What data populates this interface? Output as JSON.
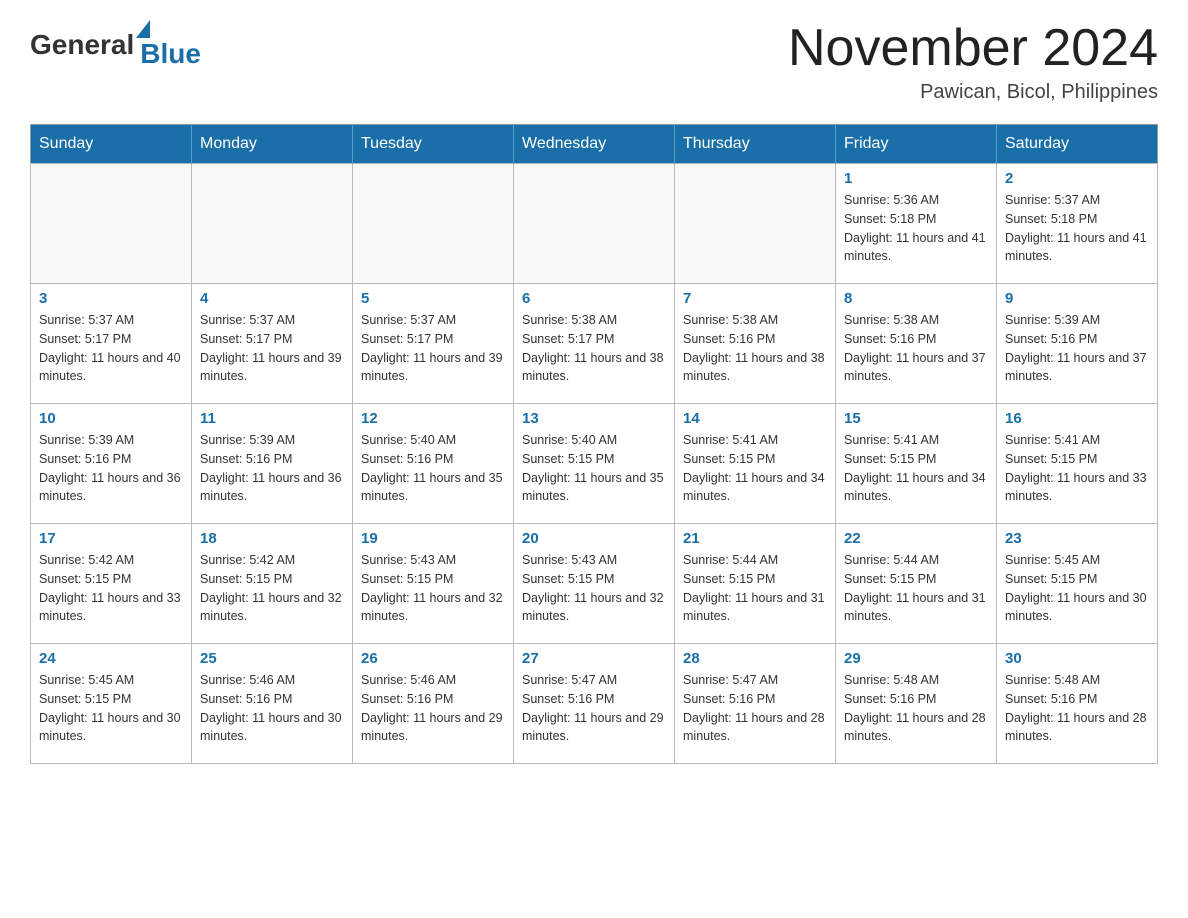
{
  "header": {
    "logo_general": "General",
    "logo_blue": "Blue",
    "month_year": "November 2024",
    "location": "Pawican, Bicol, Philippines"
  },
  "weekdays": [
    "Sunday",
    "Monday",
    "Tuesday",
    "Wednesday",
    "Thursday",
    "Friday",
    "Saturday"
  ],
  "weeks": [
    [
      {
        "day": "",
        "info": ""
      },
      {
        "day": "",
        "info": ""
      },
      {
        "day": "",
        "info": ""
      },
      {
        "day": "",
        "info": ""
      },
      {
        "day": "",
        "info": ""
      },
      {
        "day": "1",
        "info": "Sunrise: 5:36 AM\nSunset: 5:18 PM\nDaylight: 11 hours and 41 minutes."
      },
      {
        "day": "2",
        "info": "Sunrise: 5:37 AM\nSunset: 5:18 PM\nDaylight: 11 hours and 41 minutes."
      }
    ],
    [
      {
        "day": "3",
        "info": "Sunrise: 5:37 AM\nSunset: 5:17 PM\nDaylight: 11 hours and 40 minutes."
      },
      {
        "day": "4",
        "info": "Sunrise: 5:37 AM\nSunset: 5:17 PM\nDaylight: 11 hours and 39 minutes."
      },
      {
        "day": "5",
        "info": "Sunrise: 5:37 AM\nSunset: 5:17 PM\nDaylight: 11 hours and 39 minutes."
      },
      {
        "day": "6",
        "info": "Sunrise: 5:38 AM\nSunset: 5:17 PM\nDaylight: 11 hours and 38 minutes."
      },
      {
        "day": "7",
        "info": "Sunrise: 5:38 AM\nSunset: 5:16 PM\nDaylight: 11 hours and 38 minutes."
      },
      {
        "day": "8",
        "info": "Sunrise: 5:38 AM\nSunset: 5:16 PM\nDaylight: 11 hours and 37 minutes."
      },
      {
        "day": "9",
        "info": "Sunrise: 5:39 AM\nSunset: 5:16 PM\nDaylight: 11 hours and 37 minutes."
      }
    ],
    [
      {
        "day": "10",
        "info": "Sunrise: 5:39 AM\nSunset: 5:16 PM\nDaylight: 11 hours and 36 minutes."
      },
      {
        "day": "11",
        "info": "Sunrise: 5:39 AM\nSunset: 5:16 PM\nDaylight: 11 hours and 36 minutes."
      },
      {
        "day": "12",
        "info": "Sunrise: 5:40 AM\nSunset: 5:16 PM\nDaylight: 11 hours and 35 minutes."
      },
      {
        "day": "13",
        "info": "Sunrise: 5:40 AM\nSunset: 5:15 PM\nDaylight: 11 hours and 35 minutes."
      },
      {
        "day": "14",
        "info": "Sunrise: 5:41 AM\nSunset: 5:15 PM\nDaylight: 11 hours and 34 minutes."
      },
      {
        "day": "15",
        "info": "Sunrise: 5:41 AM\nSunset: 5:15 PM\nDaylight: 11 hours and 34 minutes."
      },
      {
        "day": "16",
        "info": "Sunrise: 5:41 AM\nSunset: 5:15 PM\nDaylight: 11 hours and 33 minutes."
      }
    ],
    [
      {
        "day": "17",
        "info": "Sunrise: 5:42 AM\nSunset: 5:15 PM\nDaylight: 11 hours and 33 minutes."
      },
      {
        "day": "18",
        "info": "Sunrise: 5:42 AM\nSunset: 5:15 PM\nDaylight: 11 hours and 32 minutes."
      },
      {
        "day": "19",
        "info": "Sunrise: 5:43 AM\nSunset: 5:15 PM\nDaylight: 11 hours and 32 minutes."
      },
      {
        "day": "20",
        "info": "Sunrise: 5:43 AM\nSunset: 5:15 PM\nDaylight: 11 hours and 32 minutes."
      },
      {
        "day": "21",
        "info": "Sunrise: 5:44 AM\nSunset: 5:15 PM\nDaylight: 11 hours and 31 minutes."
      },
      {
        "day": "22",
        "info": "Sunrise: 5:44 AM\nSunset: 5:15 PM\nDaylight: 11 hours and 31 minutes."
      },
      {
        "day": "23",
        "info": "Sunrise: 5:45 AM\nSunset: 5:15 PM\nDaylight: 11 hours and 30 minutes."
      }
    ],
    [
      {
        "day": "24",
        "info": "Sunrise: 5:45 AM\nSunset: 5:15 PM\nDaylight: 11 hours and 30 minutes."
      },
      {
        "day": "25",
        "info": "Sunrise: 5:46 AM\nSunset: 5:16 PM\nDaylight: 11 hours and 30 minutes."
      },
      {
        "day": "26",
        "info": "Sunrise: 5:46 AM\nSunset: 5:16 PM\nDaylight: 11 hours and 29 minutes."
      },
      {
        "day": "27",
        "info": "Sunrise: 5:47 AM\nSunset: 5:16 PM\nDaylight: 11 hours and 29 minutes."
      },
      {
        "day": "28",
        "info": "Sunrise: 5:47 AM\nSunset: 5:16 PM\nDaylight: 11 hours and 28 minutes."
      },
      {
        "day": "29",
        "info": "Sunrise: 5:48 AM\nSunset: 5:16 PM\nDaylight: 11 hours and 28 minutes."
      },
      {
        "day": "30",
        "info": "Sunrise: 5:48 AM\nSunset: 5:16 PM\nDaylight: 11 hours and 28 minutes."
      }
    ]
  ]
}
